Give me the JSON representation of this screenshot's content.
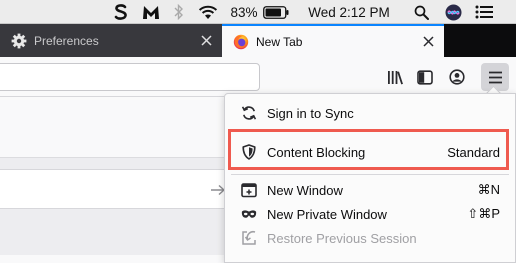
{
  "menubar": {
    "battery_percent": "83%",
    "clock": "Wed 2:12 PM",
    "icons": [
      "scrivener-icon",
      "malwarebytes-icon",
      "bluetooth-icon",
      "wifi-icon",
      "battery-icon",
      "spotlight-search-icon",
      "siri-icon",
      "notification-center-icon"
    ]
  },
  "tabs": [
    {
      "label": "Preferences",
      "icon": "gear-icon",
      "active": false
    },
    {
      "label": "New Tab",
      "icon": "firefox-icon",
      "active": true
    }
  ],
  "toolbar": {
    "url_value": "",
    "icons": [
      "library-icon",
      "sidebar-icon",
      "account-icon",
      "hamburger-menu-icon"
    ]
  },
  "menu": {
    "sign_in": "Sign in to Sync",
    "content_blocking": {
      "label": "Content Blocking",
      "value": "Standard"
    },
    "new_window": {
      "label": "New Window",
      "shortcut": "⌘N"
    },
    "new_private_window": {
      "label": "New Private Window",
      "shortcut": "⇧⌘P"
    },
    "restore_session": {
      "label": "Restore Previous Session"
    }
  },
  "colors": {
    "highlight_border": "#ef5a4f",
    "active_tab_accent": "#0a84ff",
    "tab_strip_bg": "#0c0c0d"
  }
}
